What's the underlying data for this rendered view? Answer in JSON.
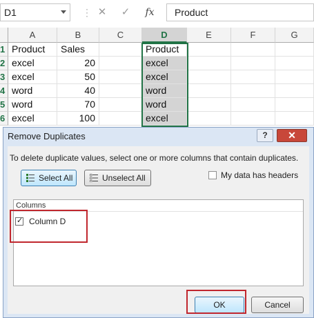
{
  "formula_bar": {
    "name_box": "D1",
    "cancel_icon": "✕",
    "enter_icon": "✓",
    "fx_label": "fx",
    "formula": "Product"
  },
  "sheet": {
    "columns": [
      "A",
      "B",
      "C",
      "D",
      "E",
      "F",
      "G"
    ],
    "selected_column": "D",
    "rows": [
      "1",
      "2",
      "3",
      "4",
      "5",
      "6"
    ],
    "cells": [
      [
        "Product",
        "Sales",
        "",
        "Product"
      ],
      [
        "excel",
        "20",
        "",
        "excel"
      ],
      [
        "excel",
        "50",
        "",
        "excel"
      ],
      [
        "word",
        "40",
        "",
        "word"
      ],
      [
        "word",
        "70",
        "",
        "word"
      ],
      [
        "excel",
        "100",
        "",
        "excel"
      ]
    ],
    "colors": {
      "accent": "#217346",
      "selection_fill": "#d4d4d4"
    }
  },
  "dialog": {
    "title": "Remove Duplicates",
    "help_icon": "?",
    "close_icon": "✕",
    "instruction": "To delete duplicate values, select one or more columns that contain duplicates.",
    "select_all": "Select All",
    "unselect_all": "Unselect All",
    "my_data_has_headers": "My data has headers",
    "headers_checked": false,
    "columns_header": "Columns",
    "column_items": [
      {
        "label": "Column D",
        "checked": true
      }
    ],
    "ok": "OK",
    "cancel": "Cancel",
    "colors": {
      "highlight": "#c0262d",
      "frame": "#dbe6f4"
    }
  }
}
